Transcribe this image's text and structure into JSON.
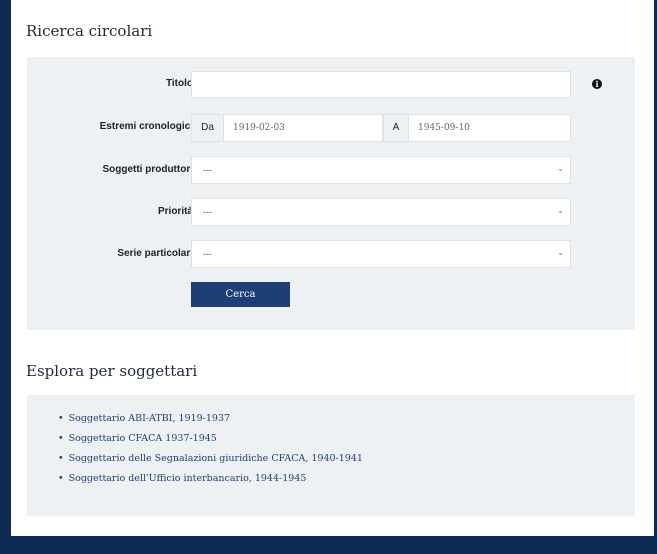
{
  "search": {
    "title": "Ricerca circolari",
    "titolo_label": "Titolo",
    "titolo_value": "",
    "estremi_label": "Estremi cronologici",
    "da_label": "Da",
    "da_value": "1919-02-03",
    "a_label": "A",
    "a_value": "1945-09-10",
    "soggetti_label": "Soggetti produttori",
    "soggetti_value": "---",
    "priorita_label": "Priorità",
    "priorita_value": "---",
    "serie_label": "Serie particolari",
    "serie_value": "---",
    "button_label": "Cerca",
    "info_glyph": "i"
  },
  "explore": {
    "title": "Esplora per soggettari",
    "items": [
      "Soggettario ABI-ATBI, 1919-1937",
      "Soggettario CFACA 1937-1945",
      "Soggettario delle Segnalazioni giuridiche CFACA, 1940-1941",
      "Soggettario dell'Ufficio interbancario, 1944-1945"
    ]
  },
  "colors": {
    "brand_navy": "#0d2b55",
    "button_blue": "#1d3f78",
    "panel_bg": "#eef1f4"
  },
  "icons": {
    "info": "info-icon",
    "select_chevron": "chevron-down-icon"
  }
}
